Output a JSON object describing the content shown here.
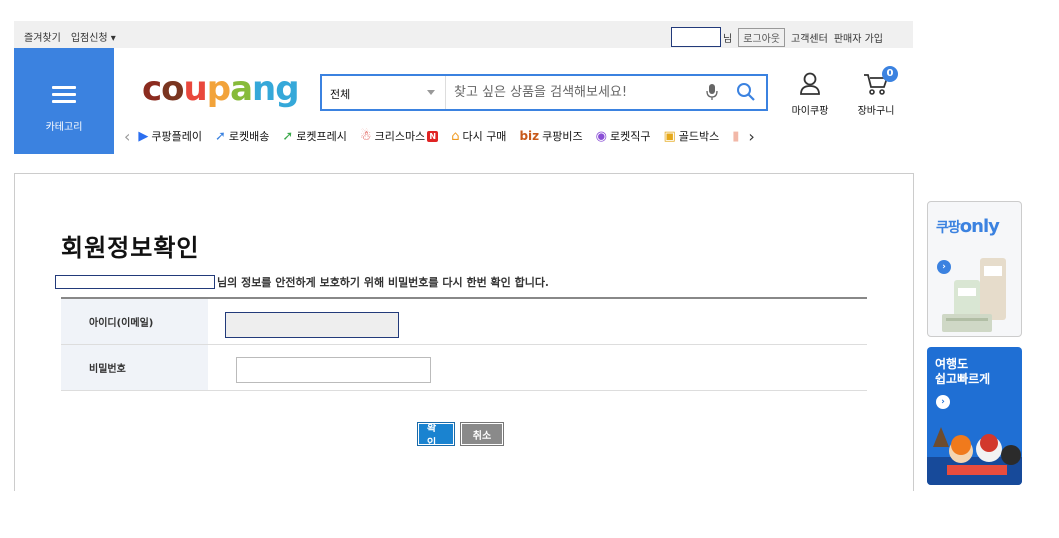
{
  "topbar": {
    "bookmark": "즐겨찾기",
    "seller_apply": "입점신청 ▾",
    "user_suffix": "님",
    "logout": "로그아웃",
    "customer_center": "고객센터",
    "seller_join": "판매자 가입"
  },
  "header": {
    "category_label": "카테고리",
    "logo": [
      "c",
      "o",
      "u",
      "p",
      "a",
      "ng"
    ],
    "search": {
      "category": "전체",
      "placeholder": "찾고 싶은 상품을 검색해보세요!"
    },
    "my_coupang": "마이쿠팡",
    "cart": "장바구니",
    "cart_count": "0"
  },
  "catnav": {
    "prev": "‹",
    "next": "›",
    "items": [
      {
        "label": "쿠팡플레이",
        "icon": "play-icon",
        "glyph": "▶",
        "color": "#2a6ef0"
      },
      {
        "label": "로켓배송",
        "icon": "rocket-icon",
        "glyph": "🚀",
        "color": "#3b82e0"
      },
      {
        "label": "로켓프레시",
        "icon": "fresh-rocket-icon",
        "glyph": "🚀",
        "color": "#3aa84a"
      },
      {
        "label": "크리스마스",
        "icon": "santa-icon",
        "glyph": "🎅",
        "color": "#d8332b",
        "badge": "N"
      },
      {
        "label": "다시 구매",
        "icon": "home-icon",
        "glyph": "⌂",
        "color": "#f09a20"
      },
      {
        "label": "쿠팡비즈",
        "icon": "biz-icon",
        "glyph": "biz",
        "color": "#c85a1b"
      },
      {
        "label": "로켓직구",
        "icon": "global-rocket-icon",
        "glyph": "🚀",
        "color": "#8a4fd6"
      },
      {
        "label": "골드박스",
        "icon": "gold-box-icon",
        "glyph": "🎁",
        "color": "#e5a81a"
      },
      {
        "label": "",
        "icon": "bag-icon",
        "glyph": "▮",
        "color": "#f2b8a8"
      }
    ]
  },
  "main": {
    "title": "회원정보확인",
    "notice": "님의 정보를 안전하게 보호하기 위해 비밀번호를 다시 한번 확인 합니다.",
    "id_label": "아이디(이메일)",
    "pw_label": "비밀번호",
    "confirm": "확인",
    "cancel": "취소"
  },
  "ads": {
    "ad1_brand": "쿠팡",
    "ad1_suffix": "only",
    "ad2_line1": "여행도",
    "ad2_line2": "쉽고빠르게"
  }
}
